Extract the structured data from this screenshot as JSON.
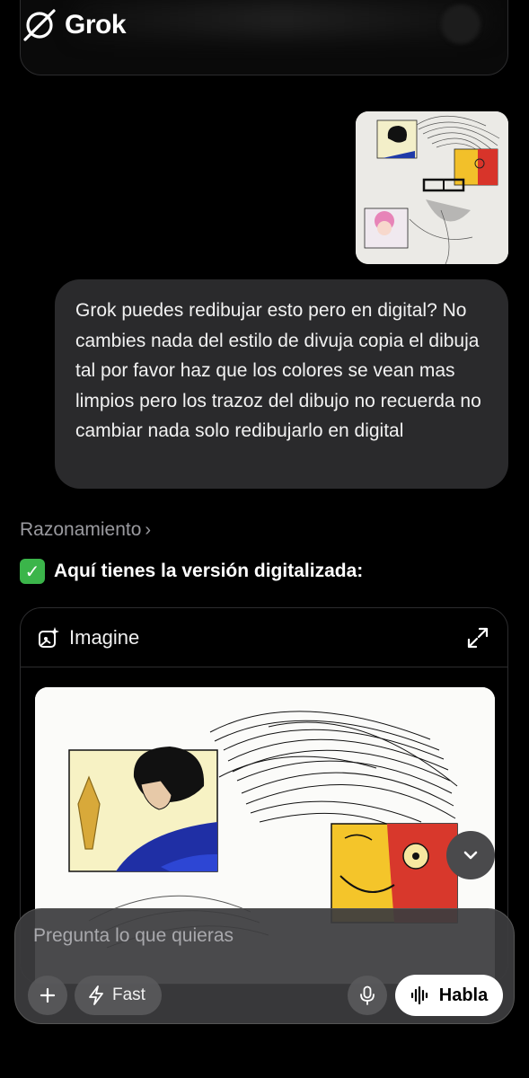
{
  "header": {
    "app_name": "Grok",
    "logo_icon": "grok-logo-icon"
  },
  "conversation": {
    "user_message": "Grok puedes redibujar esto pero en digital? No cambies nada del estilo de divuja copia el dibuja tal por favor haz que los colores se vean mas limpios pero los trazoz del dibujo no recuerda no cambiar nada solo redibujarlo en digital",
    "reasoning_label": "Razonamiento",
    "answer_text": "Aquí tienes la versión digitalizada:",
    "answer_emoji": "white-check-mark"
  },
  "imagine": {
    "title": "Imagine",
    "icon": "imagine-sparkle-icon",
    "expand_icon": "expand-icon"
  },
  "composer": {
    "placeholder": "Pregunta lo que quieras",
    "fast_label": "Fast",
    "habla_label": "Habla"
  },
  "colors": {
    "background": "#000000",
    "bubble": "#2a2a2c",
    "accent_green": "#3bb54a"
  }
}
